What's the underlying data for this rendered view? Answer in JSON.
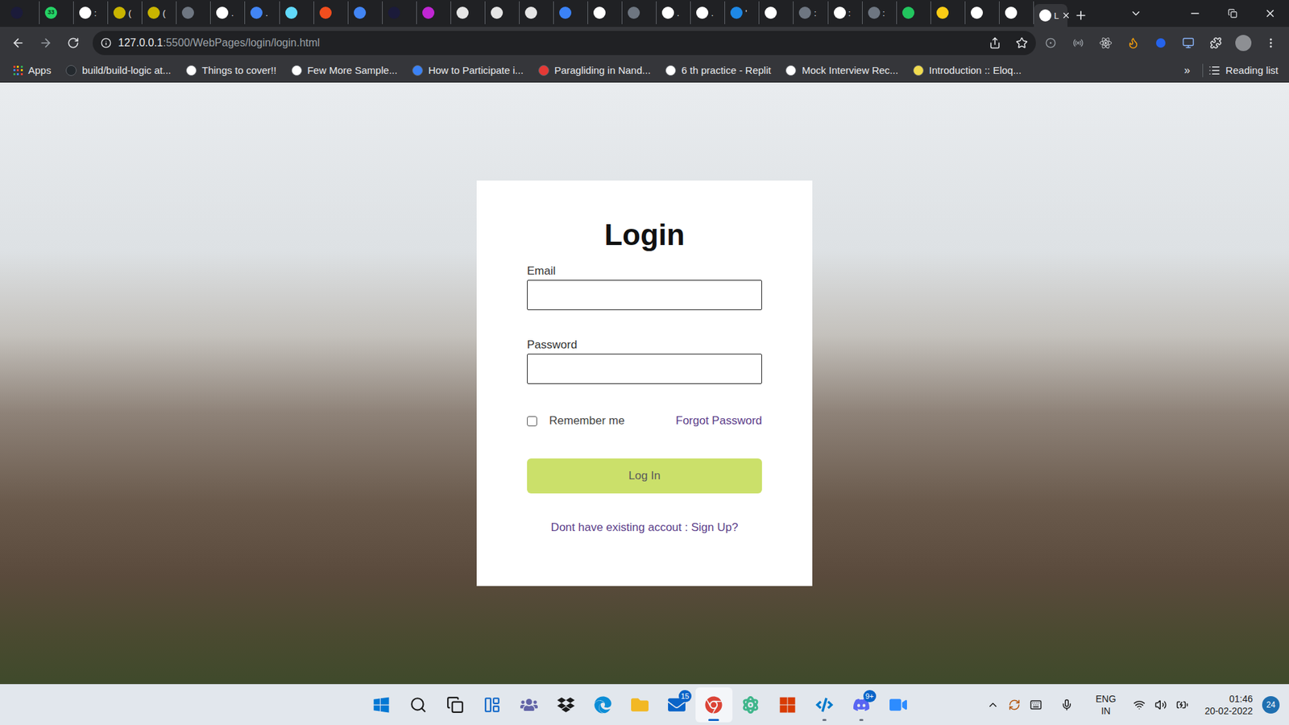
{
  "browser": {
    "tabs": [
      {
        "label": "",
        "badge": "",
        "color": "#1b1b3a",
        "selected": false
      },
      {
        "label": "",
        "badge": "33",
        "color": "#25d366",
        "selected": false
      },
      {
        "label": ":",
        "badge": "",
        "color": "#ffffff",
        "selected": false
      },
      {
        "label": "(",
        "badge": "",
        "color": "#c9b400",
        "selected": false
      },
      {
        "label": "(",
        "badge": "",
        "color": "#c9b400",
        "selected": false
      },
      {
        "label": "",
        "badge": "",
        "color": "#6e7681",
        "selected": false
      },
      {
        "label": ".",
        "badge": "",
        "color": "#ffffff",
        "selected": false
      },
      {
        "label": ".",
        "badge": "",
        "color": "#4285f4",
        "selected": false
      },
      {
        "label": "",
        "badge": "",
        "color": "#61dafb",
        "selected": false
      },
      {
        "label": "",
        "badge": "",
        "color": "#f24e1e",
        "selected": false
      },
      {
        "label": "",
        "badge": "",
        "color": "#4285f4",
        "selected": false
      },
      {
        "label": "",
        "badge": "",
        "color": "#1b1b3a",
        "selected": false
      },
      {
        "label": "",
        "badge": "",
        "color": "#c026d3",
        "selected": false
      },
      {
        "label": "",
        "badge": "",
        "color": "#e5e5e5",
        "selected": false
      },
      {
        "label": "",
        "badge": "",
        "color": "#e5e5e5",
        "selected": false
      },
      {
        "label": "",
        "badge": "",
        "color": "#e5e5e5",
        "selected": false
      },
      {
        "label": "",
        "badge": "",
        "color": "#3b82f6",
        "selected": false
      },
      {
        "label": "",
        "badge": "",
        "color": "#ffffff",
        "selected": false
      },
      {
        "label": "",
        "badge": "",
        "color": "#6e7681",
        "selected": false
      },
      {
        "label": ".",
        "badge": "",
        "color": "#ffffff",
        "selected": false
      },
      {
        "label": ".",
        "badge": "",
        "color": "#ffffff",
        "selected": false
      },
      {
        "label": "'",
        "badge": "",
        "color": "#1e88e5",
        "selected": false
      },
      {
        "label": "",
        "badge": "",
        "color": "#ffffff",
        "selected": false
      },
      {
        "label": ":",
        "badge": "",
        "color": "#6e7681",
        "selected": false
      },
      {
        "label": ":",
        "badge": "",
        "color": "#ffffff",
        "selected": false
      },
      {
        "label": ":",
        "badge": "",
        "color": "#6e7681",
        "selected": false
      },
      {
        "label": "",
        "badge": "",
        "color": "#22c55e",
        "selected": false
      },
      {
        "label": "",
        "badge": "",
        "color": "#facc15",
        "selected": false
      },
      {
        "label": "",
        "badge": "",
        "color": "#ffffff",
        "selected": false
      },
      {
        "label": "",
        "badge": "",
        "color": "#ffffff",
        "selected": false
      },
      {
        "label": "L",
        "badge": "",
        "color": "#ffffff",
        "selected": true
      }
    ],
    "address": {
      "host": "127.0.0.1",
      "path": ":5500/WebPages/login/login.html"
    },
    "bookmarks": [
      {
        "label": "Apps",
        "kind": "apps",
        "color": "#4285f4"
      },
      {
        "label": "build/build-logic at...",
        "kind": "site",
        "color": "#24292e"
      },
      {
        "label": "Things to cover!!",
        "kind": "site",
        "color": "#ffffff"
      },
      {
        "label": "Few More Sample...",
        "kind": "site",
        "color": "#ffffff"
      },
      {
        "label": "How to Participate i...",
        "kind": "site",
        "color": "#3b82f6"
      },
      {
        "label": "Paragliding in Nand...",
        "kind": "site",
        "color": "#e53935"
      },
      {
        "label": "6 th practice - Replit",
        "kind": "site",
        "color": "#ffffff"
      },
      {
        "label": "Mock Interview Rec...",
        "kind": "site",
        "color": "#ffffff"
      },
      {
        "label": "Introduction :: Eloq...",
        "kind": "site",
        "color": "#f0db4f"
      }
    ],
    "overflow": "»",
    "reading_list": "Reading list"
  },
  "page": {
    "title": "Login",
    "fields": [
      {
        "label": "Email",
        "type": "email",
        "value": ""
      },
      {
        "label": "Password",
        "type": "password",
        "value": ""
      }
    ],
    "remember": {
      "label": "Remember me",
      "checked": false
    },
    "forgot": "Forgot Password",
    "submit": "Log In",
    "signup": "Dont have existing accout : Sign Up?"
  },
  "taskbar": {
    "apps": [
      {
        "kind": "start",
        "badge": "",
        "running": false,
        "selected": false
      },
      {
        "kind": "search",
        "badge": "",
        "running": false,
        "selected": false
      },
      {
        "kind": "taskview",
        "badge": "",
        "running": false,
        "selected": false
      },
      {
        "kind": "widgets",
        "badge": "",
        "running": false,
        "selected": false
      },
      {
        "kind": "chat",
        "badge": "",
        "running": false,
        "selected": false
      },
      {
        "kind": "dropbox",
        "badge": "",
        "running": false,
        "selected": false
      },
      {
        "kind": "edge",
        "badge": "",
        "running": false,
        "selected": false
      },
      {
        "kind": "explorer",
        "badge": "",
        "running": false,
        "selected": false
      },
      {
        "kind": "mail",
        "badge": "15",
        "running": false,
        "selected": false
      },
      {
        "kind": "chrome",
        "badge": "",
        "running": true,
        "selected": true
      },
      {
        "kind": "atom",
        "badge": "",
        "running": false,
        "selected": false
      },
      {
        "kind": "office",
        "badge": "",
        "running": false,
        "selected": false
      },
      {
        "kind": "vscode",
        "badge": "",
        "running": true,
        "selected": false
      },
      {
        "kind": "discord",
        "badge": "9+",
        "running": true,
        "selected": false
      },
      {
        "kind": "zoom",
        "badge": "",
        "running": false,
        "selected": false
      }
    ],
    "tray": {
      "language": "ENG",
      "region": "IN",
      "time": "01:46",
      "date": "20-02-2022",
      "notifications": "24"
    }
  }
}
